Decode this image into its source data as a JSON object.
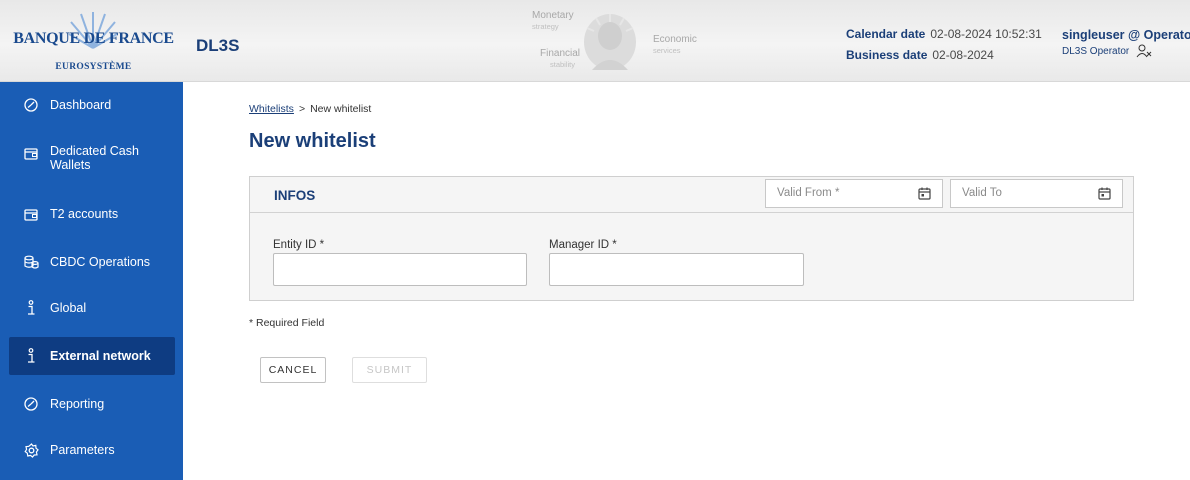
{
  "header": {
    "logo": {
      "main": "BANQUE DE FRANCE",
      "sub": "EUROSYSTÈME"
    },
    "app_name": "DL3S",
    "mission": {
      "monetary": "Monetary",
      "strategy": "strategy",
      "economic": "Economic",
      "services": "services",
      "financial": "Financial",
      "stability": "stability"
    },
    "calendar_date": {
      "label": "Calendar date",
      "value": "02-08-2024 10:52:31"
    },
    "business_date": {
      "label": "Business date",
      "value": "02-08-2024"
    },
    "user": {
      "name": "singleuser @ Operator",
      "role": "DL3S Operator"
    }
  },
  "sidebar": {
    "items": [
      {
        "label": "Dashboard",
        "icon": "dashboard-gauge-icon",
        "active": false
      },
      {
        "label": "Dedicated Cash Wallets",
        "icon": "wallet-icon",
        "active": false
      },
      {
        "label": "T2 accounts",
        "icon": "wallet-icon",
        "active": false
      },
      {
        "label": "CBDC Operations",
        "icon": "coins-icon",
        "active": false
      },
      {
        "label": "Global",
        "icon": "info-icon",
        "active": false
      },
      {
        "label": "External network",
        "icon": "info-icon",
        "active": true
      },
      {
        "label": "Reporting",
        "icon": "gauge-icon",
        "active": false
      },
      {
        "label": "Parameters",
        "icon": "gear-icon",
        "active": false
      }
    ]
  },
  "breadcrumb": {
    "link": "Whitelists",
    "separator": ">",
    "current": "New whitelist"
  },
  "page_title": "New whitelist",
  "form": {
    "section_title": "INFOS",
    "valid_from": {
      "placeholder": "Valid From *",
      "value": ""
    },
    "valid_to": {
      "placeholder": "Valid To",
      "value": ""
    },
    "entity_id": {
      "label": "Entity ID *",
      "value": ""
    },
    "manager_id": {
      "label": "Manager ID *",
      "value": ""
    },
    "required_note": "* Required Field",
    "cancel_label": "CANCEL",
    "submit_label": "SUBMIT",
    "submit_enabled": false
  },
  "colors": {
    "brand_blue": "#1b3f78",
    "sidebar_bg": "#1a5db5",
    "sidebar_active": "#0e3c82",
    "card_bg": "#f5f5f5"
  }
}
